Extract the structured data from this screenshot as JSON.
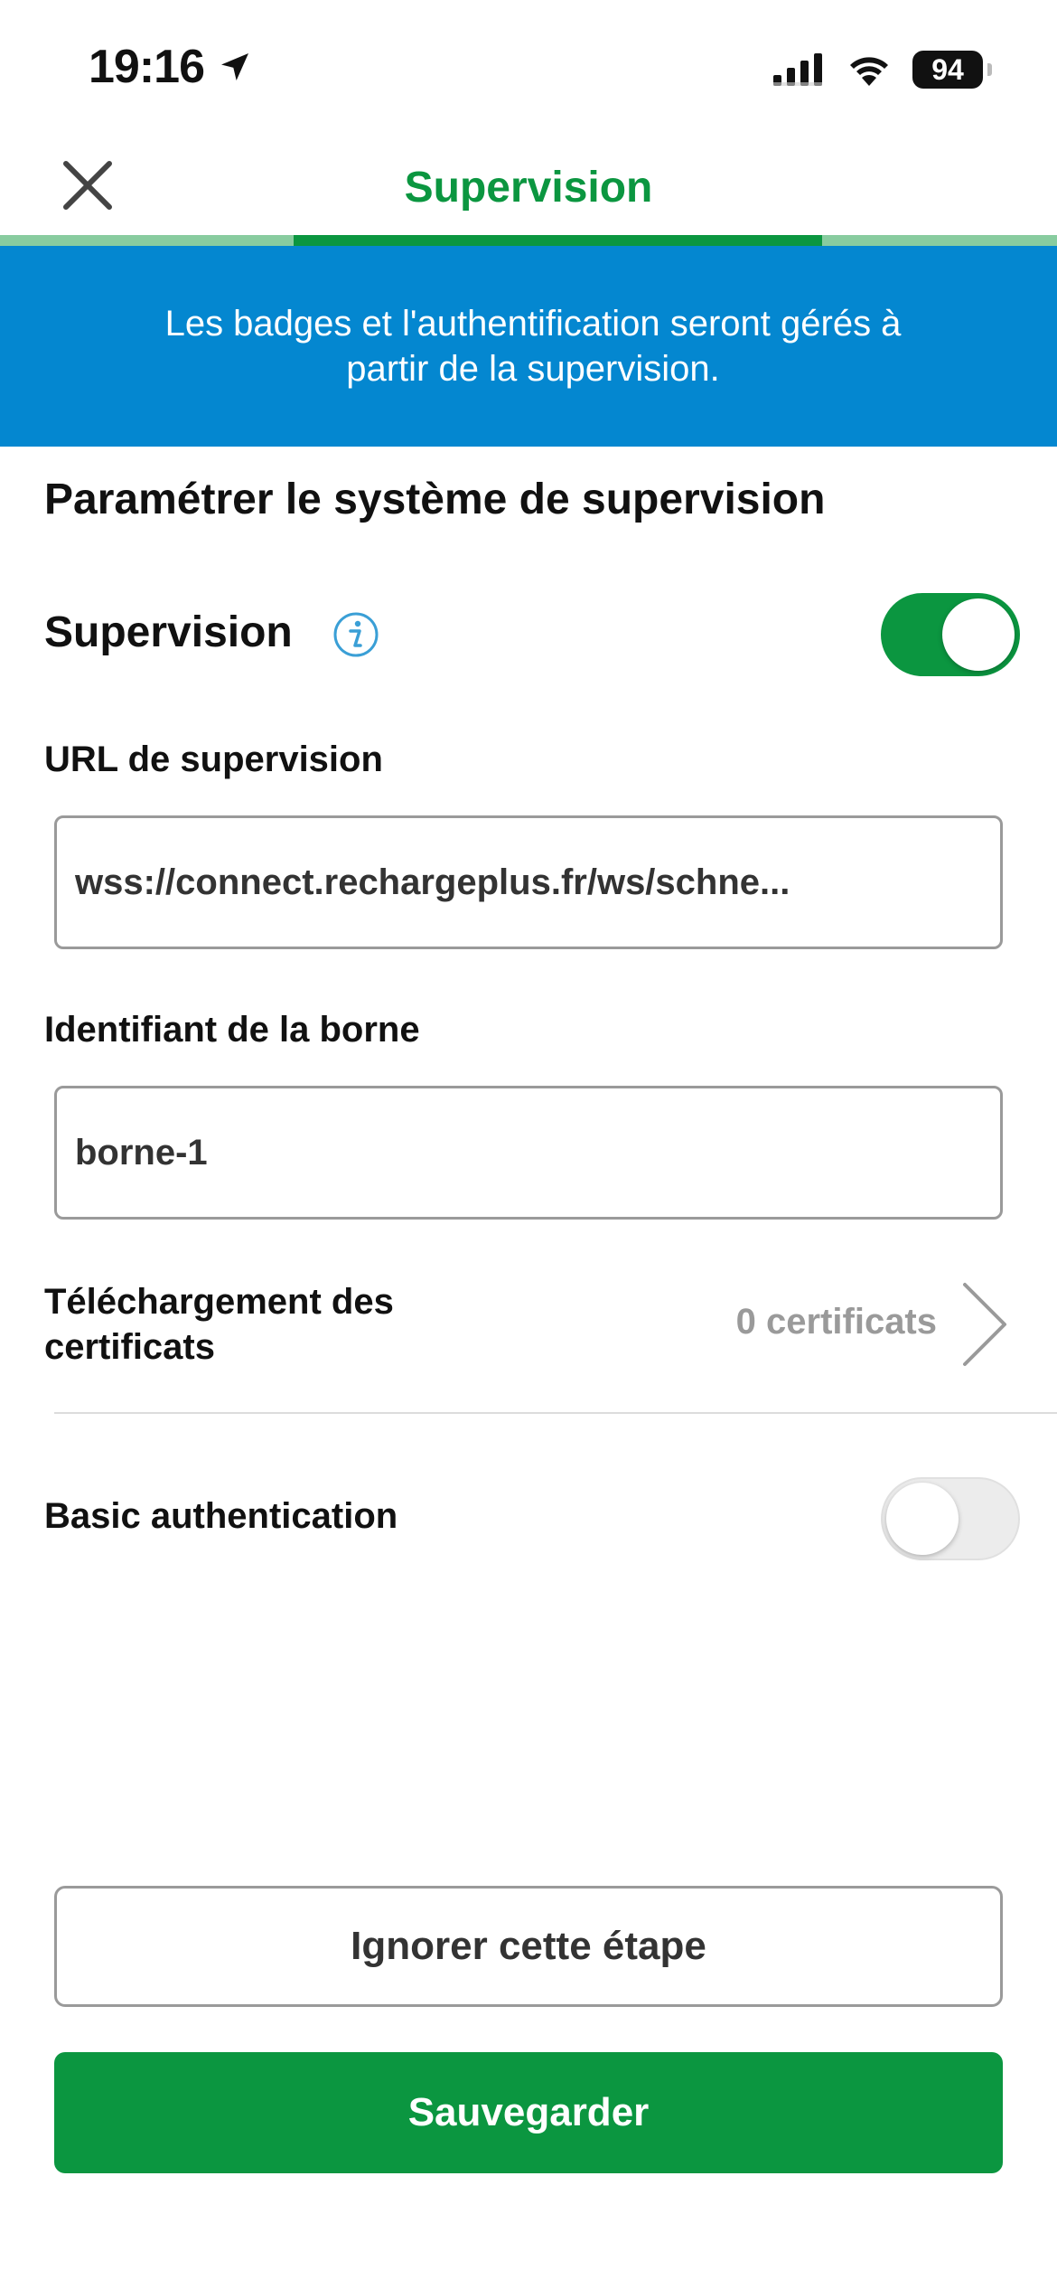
{
  "status_bar": {
    "time": "19:16",
    "battery": "94",
    "icons": [
      "location-arrow-icon",
      "signal-icon",
      "wifi-icon",
      "battery-icon"
    ]
  },
  "header": {
    "title": "Supervision",
    "close_icon": "close-icon",
    "step_progress": {
      "current_step": 2,
      "total_steps": 3
    }
  },
  "banner": {
    "text": "Les badges et l'authentification seront gérés à partir de la supervision."
  },
  "form": {
    "section_title": "Paramétrer le système de supervision",
    "supervision": {
      "label": "Supervision",
      "info_icon": "info-icon",
      "enabled": true
    },
    "url": {
      "label": "URL de supervision",
      "value": "wss://connect.rechargeplus.fr/ws/schne..."
    },
    "station_id": {
      "label": "Identifiant de la borne",
      "value": "borne-1"
    },
    "certificates": {
      "label": "Téléchargement des certificats",
      "value": "0 certificats",
      "chevron_icon": "chevron-right-icon"
    },
    "basic_auth": {
      "label": "Basic authentication",
      "enabled": false
    }
  },
  "actions": {
    "skip_label": "Ignorer cette étape",
    "save_label": "Sauvegarder"
  },
  "colors": {
    "brand_green": "#0b9640",
    "progress_track": "#88cc9f",
    "banner_blue": "#0487d0",
    "info_blue": "#3a9fd6",
    "muted_text": "#9a9a9a"
  }
}
